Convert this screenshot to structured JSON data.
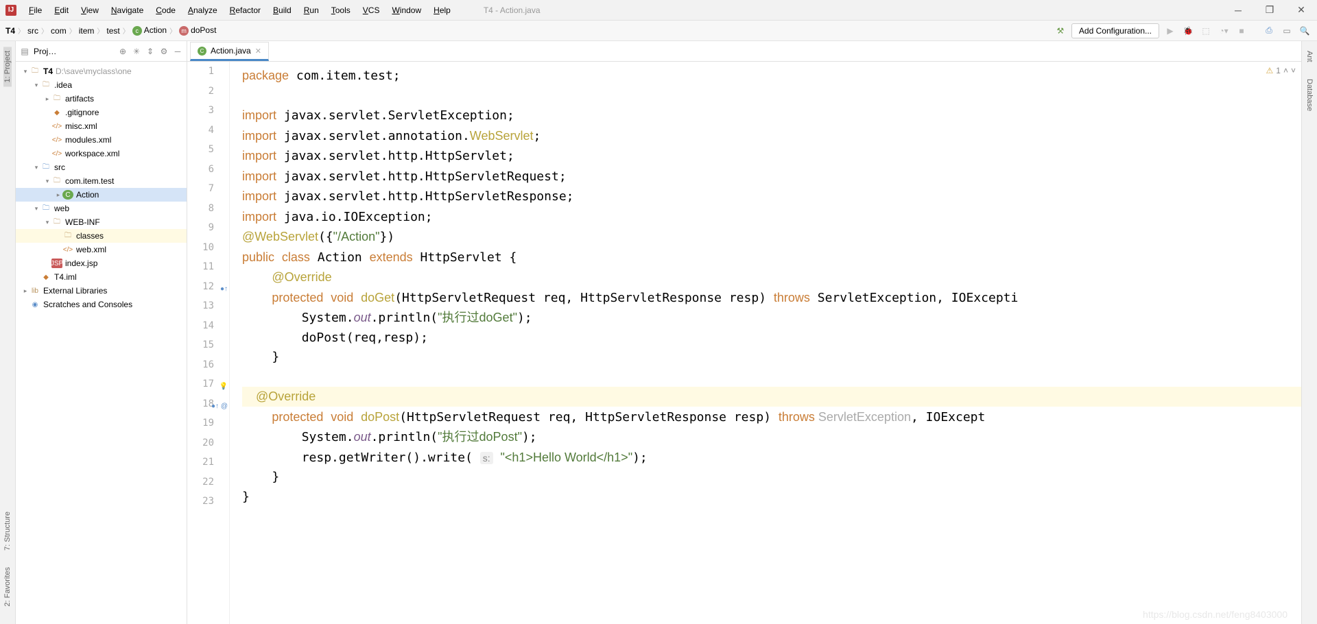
{
  "title": "T4 - Action.java",
  "menu": [
    "File",
    "Edit",
    "View",
    "Navigate",
    "Code",
    "Analyze",
    "Refactor",
    "Build",
    "Run",
    "Tools",
    "VCS",
    "Window",
    "Help"
  ],
  "breadcrumbs": [
    {
      "label": "T4",
      "bold": true
    },
    {
      "label": "src"
    },
    {
      "label": "com"
    },
    {
      "label": "item"
    },
    {
      "label": "test"
    },
    {
      "label": "Action",
      "icon": "c",
      "iconbg": "#6aa84f"
    },
    {
      "label": "doPost",
      "icon": "m",
      "iconbg": "#c96a6a"
    }
  ],
  "addConfig": "Add Configuration...",
  "leftTabs": [
    "1: Project"
  ],
  "bottomLeft": [
    "7: Structure",
    "2: Favorites"
  ],
  "rightTabs": [
    "Ant",
    "Database"
  ],
  "projectTitle": "Proj…",
  "tree": [
    {
      "indent": 0,
      "arrow": "▾",
      "icon": "folder",
      "iconcls": "folder",
      "label": "T4",
      "bold": true,
      "path": "D:\\save\\myclass\\one"
    },
    {
      "indent": 1,
      "arrow": "▾",
      "icon": "folder",
      "iconcls": "folder",
      "label": ".idea"
    },
    {
      "indent": 2,
      "arrow": "▸",
      "icon": "folder",
      "iconcls": "folder",
      "label": "artifacts"
    },
    {
      "indent": 2,
      "arrow": "",
      "icon": "◆",
      "iconcls": "file-xml",
      "label": ".gitignore"
    },
    {
      "indent": 2,
      "arrow": "",
      "icon": "</>",
      "iconcls": "file-xml",
      "label": "misc.xml"
    },
    {
      "indent": 2,
      "arrow": "",
      "icon": "</>",
      "iconcls": "file-xml",
      "label": "modules.xml"
    },
    {
      "indent": 2,
      "arrow": "",
      "icon": "</>",
      "iconcls": "file-xml",
      "label": "workspace.xml"
    },
    {
      "indent": 1,
      "arrow": "▾",
      "icon": "folder",
      "iconcls": "folder-blue",
      "label": "src"
    },
    {
      "indent": 2,
      "arrow": "▾",
      "icon": "folder",
      "iconcls": "folder",
      "label": "com.item.test"
    },
    {
      "indent": 3,
      "arrow": "▸",
      "icon": "C",
      "iconcls": "file-java",
      "label": "Action",
      "sel": true
    },
    {
      "indent": 1,
      "arrow": "▾",
      "icon": "folder",
      "iconcls": "folder-blue",
      "label": "web"
    },
    {
      "indent": 2,
      "arrow": "▾",
      "icon": "folder",
      "iconcls": "folder",
      "label": "WEB-INF"
    },
    {
      "indent": 3,
      "arrow": "",
      "icon": "folder",
      "iconcls": "folder",
      "label": "classes",
      "hl": true
    },
    {
      "indent": 3,
      "arrow": "",
      "icon": "</>",
      "iconcls": "file-xml",
      "label": "web.xml"
    },
    {
      "indent": 2,
      "arrow": "",
      "icon": "JSP",
      "iconcls": "file-jsp",
      "label": "index.jsp"
    },
    {
      "indent": 1,
      "arrow": "",
      "icon": "◆",
      "iconcls": "file-xml",
      "label": "T4.iml"
    },
    {
      "indent": 0,
      "arrow": "▸",
      "icon": "lib",
      "iconcls": "folder",
      "label": "External Libraries"
    },
    {
      "indent": 0,
      "arrow": "",
      "icon": "◉",
      "iconcls": "folder-blue",
      "label": "Scratches and Consoles"
    }
  ],
  "tab": {
    "label": "Action.java"
  },
  "warningCount": "1",
  "lines": [
    1,
    2,
    3,
    4,
    5,
    6,
    7,
    8,
    9,
    10,
    11,
    12,
    13,
    14,
    15,
    16,
    17,
    18,
    19,
    20,
    21,
    22,
    23
  ],
  "gutterMarks": {
    "12": "●↑",
    "17": "💡",
    "18": "●↑ @"
  },
  "code": {
    "l1_pkg": "package",
    "l1_rest": " com.item.test;",
    "l3_imp": "import",
    "l3_rest": " javax.servlet.ServletException;",
    "l4_imp": "import",
    "l4_a": " javax.servlet.annotation.",
    "l4_ws": "WebServlet",
    "l4_b": ";",
    "l5_imp": "import",
    "l5_rest": " javax.servlet.http.HttpServlet;",
    "l6_imp": "import",
    "l6_rest": " javax.servlet.http.HttpServletRequest;",
    "l7_imp": "import",
    "l7_rest": " javax.servlet.http.HttpServletResponse;",
    "l8_imp": "import",
    "l8_rest": " java.io.IOException;",
    "l9_ann": "@WebServlet",
    "l9_a": "({",
    "l9_str": "\"/Action\"",
    "l9_b": "})",
    "l10_pub": "public",
    "l10_cls": "class",
    "l10_name": " Action ",
    "l10_ext": "extends",
    "l10_rest": " HttpServlet {",
    "l11_ann": "@Override",
    "l12_prot": "protected",
    "l12_void": "void",
    "l12_m": "doGet",
    "l12_sig": "(HttpServletRequest req, HttpServletResponse resp) ",
    "l12_thr": "throws",
    "l12_rest": " ServletException, IOExcepti",
    "l13_a": "System.",
    "l13_out": "out",
    "l13_b": ".println(",
    "l13_str": "\"执行过doGet\"",
    "l13_c": ");",
    "l14": "doPost(req,resp);",
    "l15": "}",
    "l17_ann": "@Override",
    "l18_prot": "protected",
    "l18_void": "void",
    "l18_m": "doPost",
    "l18_sig": "(HttpServletRequest req, HttpServletResponse resp) ",
    "l18_thr": "throws",
    "l18_exc": " ServletException",
    "l18_rest": ", IOExcept",
    "l19_a": "System.",
    "l19_out": "out",
    "l19_b": ".println(",
    "l19_str": "\"执行过doPost\"",
    "l19_c": ");",
    "l20_a": "resp.getWriter().write( ",
    "l20_hint": "s:",
    "l20_str": "\"<h1>Hello World</h1>\"",
    "l20_b": ");",
    "l21": "}",
    "l22": "}"
  },
  "watermark": "https://blog.csdn.net/feng8403000"
}
